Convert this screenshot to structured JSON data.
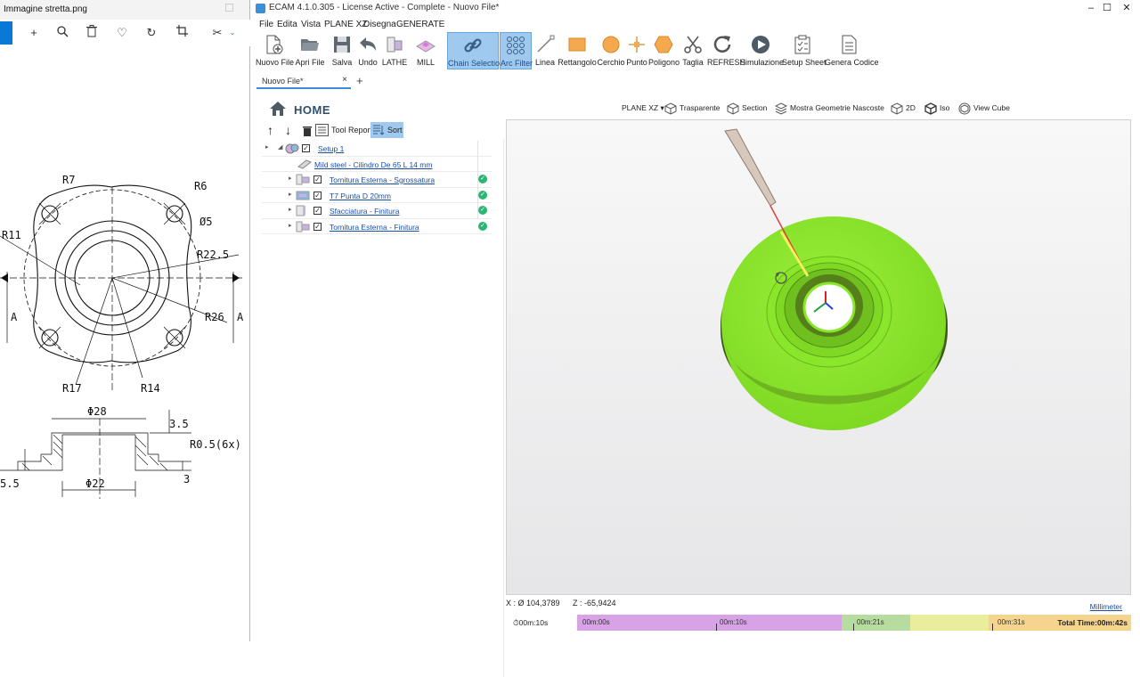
{
  "viewer": {
    "title": "Immagine stretta.png",
    "drawing_labels": {
      "r7": "R7",
      "r6": "R6",
      "d5": "Ø5",
      "r11": "R11",
      "r225": "R22.5",
      "a_left": "A",
      "a_right": "A",
      "r26": "R26",
      "r17": "R17",
      "r14": "R14",
      "d28": "Φ28",
      "d35": "3.5",
      "r05": "R0.5(6x)",
      "d55": "5.5",
      "d22": "Φ22",
      "d3": "3"
    }
  },
  "app": {
    "title": "ECAM 4.1.0.305 - License Active -  Complete  - Nuovo File*",
    "menu": [
      "File",
      "Edita",
      "Vista",
      "PLANE XZ",
      "Disegna",
      "GENERATE"
    ],
    "ribbon": [
      "Nuovo File",
      "Apri File",
      "Salva",
      "Undo",
      "LATHE",
      "MILL",
      "Chain Selection",
      "Arc Filter",
      "Linea",
      "Rettangolo",
      "Cerchio",
      "Punto",
      "Poligono",
      "Taglia",
      "REFRESH",
      "Simulazione",
      "Setup Sheet",
      "Genera Codice"
    ],
    "tab": "Nuovo File*"
  },
  "tree": {
    "home": "HOME",
    "tool_report": "Tool Report",
    "sort": "Sort",
    "rows": [
      {
        "label": "Setup 1"
      },
      {
        "label": "Mild steel - Cilindro De 65 L 14 mm"
      },
      {
        "label": "Tornitura Esterna - Sgrossatura"
      },
      {
        "label": "T7 Punta D 20mm"
      },
      {
        "label": "Sfacciatura - Finitura"
      },
      {
        "label": "Tornitura Esterna - Finitura"
      }
    ]
  },
  "viewbar": {
    "plane": "PLANE XZ",
    "trasparente": "Trasparente",
    "section": "Section",
    "mostra": "Mostra Geometrie Nascoste",
    "twod": "2D",
    "iso": "Iso",
    "viewcube": "View Cube"
  },
  "status": {
    "x": "X : Ø 104,3789",
    "z": "Z : -65,9424",
    "unit": "Millimeter"
  },
  "timeline": {
    "start": "00m:10s",
    "seg1": "00m:00s",
    "seg2": "00m:10s",
    "seg3": "00m:21s",
    "seg4": "00m:31s",
    "total": "Total Time:00m:42s"
  },
  "colors": {
    "part": "#8ae62a",
    "accent": "#3a8fd6",
    "ribbon_active": "#9fc9ee",
    "tl_purple": "#d8a3e6",
    "tl_green": "#b6dca0",
    "tl_yellow": "#e9ee9c",
    "tl_orange": "#f5d48e"
  }
}
